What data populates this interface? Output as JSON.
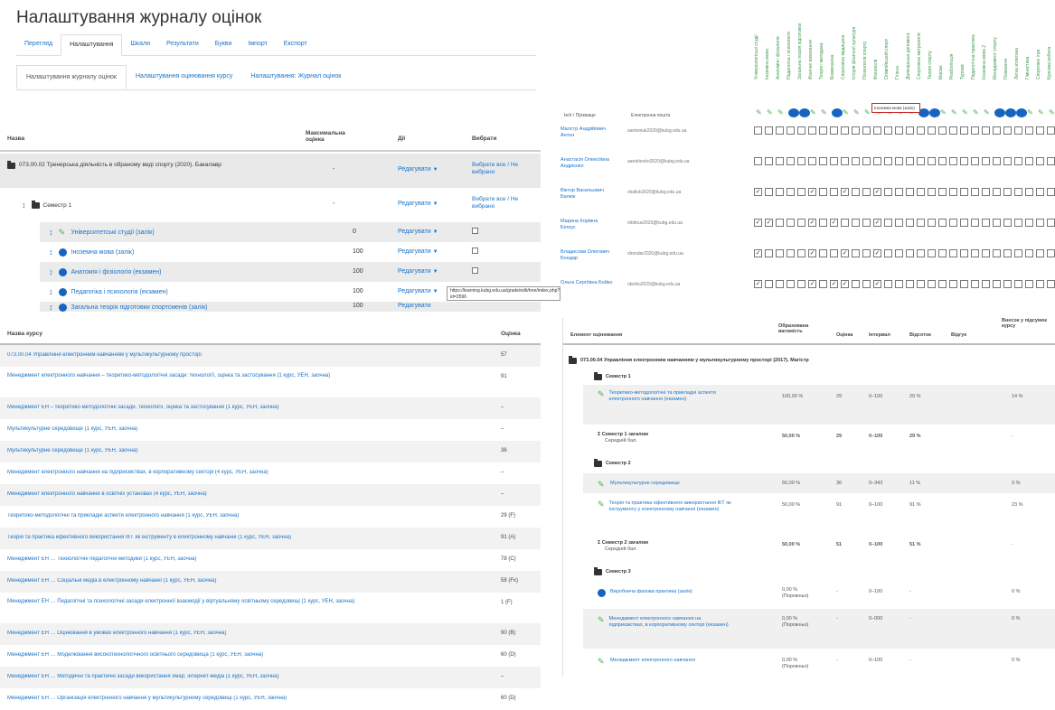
{
  "page": {
    "title": "Налаштування журналу оцінок"
  },
  "tabs_main": [
    "Перегляд",
    "Налаштування",
    "Шкали",
    "Результати",
    "Букви",
    "Імпорт",
    "Експорт"
  ],
  "tabs_sub": [
    "Налаштування журналу оцінок",
    "Налаштування оцінювання курсу",
    "Налаштування: Журнал оцінок"
  ],
  "setup_table": {
    "headers": {
      "name": "Назва",
      "max": "Максимальна оцінка",
      "actions": "Дії",
      "select": "Вибрати"
    },
    "course": {
      "name": "073.00.02 Тренерська діяльність в обраному виді спорту (2020). Бакалавр",
      "max": "-",
      "action": "Редагувати",
      "select": "Вибрати все / Не вибрано"
    },
    "category": {
      "name": "Семестр 1",
      "max": "-",
      "action": "Редагувати",
      "select": "Вибрати все / Не вибрано"
    },
    "items": [
      {
        "icon": "leaf",
        "name": "Університетські студії (залік)",
        "max": "0",
        "action": "Редагувати"
      },
      {
        "icon": "quiz",
        "name": "Іноземна мова (залік)",
        "max": "100",
        "action": "Редагувати"
      },
      {
        "icon": "quiz",
        "name": "Анатомія і фізіологія (екзамен)",
        "max": "100",
        "action": "Редагувати"
      },
      {
        "icon": "quiz",
        "name": "Педагогіка і психологія (екзамен)",
        "max": "100",
        "action": "Редагувати"
      },
      {
        "icon": "quiz",
        "name": "Загальна теорія підготовки спортсменів (залік)",
        "max": "100",
        "action": "Редагувати"
      }
    ],
    "tooltip": "https://learning.kubg.edu.ua/grade/edit/tree/index.php?id=3596"
  },
  "matrix": {
    "col_headers": [
      "Університетські студії",
      "Іноземна мова",
      "Анатомія і фізіологія",
      "Педагогіка і психологія",
      "Загальна теорія підготовки",
      "Фізичне виховання",
      "Теорія і методика",
      "Біомеханіка",
      "Спортивна медицина",
      "Історія фізичної культури",
      "Психологія спорту",
      "Фізіологія",
      "Олімпійський спорт",
      "Гігієна",
      "Долікарська допомога",
      "Спортивна метрологія",
      "Теорія спорту",
      "Масаж",
      "Реабілітація",
      "Туризм",
      "Педагогічна практика",
      "Іноземна мова 2",
      "Менеджмент спорту",
      "Плавання",
      "Легка атлетика",
      "Гімнастика",
      "Спортивні ігри",
      "Курсова робота"
    ],
    "head_name": "Ім'я / Прізвище",
    "head_email": "Електронна пошта",
    "tooltip": "Іноземна мова (залік)",
    "rows": [
      {
        "name": "Магістр Андрійович Антон",
        "email": "aantoniuk2020@kubg.edu.ua",
        "checks": []
      },
      {
        "name": "Анастасія Олексіївна Андрієнко",
        "email": "aandrienko2020@kubg.edu.ua",
        "checks": []
      },
      {
        "name": "Віктор Васильович Балюк",
        "email": "vbaliuk2020@kubg.edu.ua",
        "checks": [
          0,
          5,
          8,
          11
        ]
      },
      {
        "name": "Марина Ігорівна Білоус",
        "email": "mbilous2020@kubg.edu.ua",
        "checks": [
          0,
          1,
          5,
          7,
          11
        ]
      },
      {
        "name": "Владислав Олегович Бондар",
        "email": "vbondar2020@kubg.edu.ua",
        "checks": [
          0,
          5,
          8,
          11
        ]
      },
      {
        "name": "Ольга Сергіївна Бойко",
        "email": "oboiko2020@kubg.edu.ua",
        "checks": [
          0,
          5,
          7,
          8,
          11
        ]
      }
    ]
  },
  "courses": {
    "headers": {
      "name": "Назва курсу",
      "grade": "Оцінка"
    },
    "rows": [
      {
        "name": "073.00.04 Управління електронним навчанням у мультикультурному просторі",
        "grade": "57"
      },
      {
        "name": "Менеджмент електронного навчання – теоретико-методологічні засади: технології, оцінка та застосування (1 курс, УЕН, заочна)",
        "grade": "91",
        "tall": true
      },
      {
        "name": "Менеджмент ЕН – теоретико-методологічні засади, технології, оцінка та застосування (1 курс, УЕН, заочна)",
        "grade": "–"
      },
      {
        "name": "Мультикультурне середовище (1 курс, УЕН, заочна)",
        "grade": "–"
      },
      {
        "name": "Мультикультурне середовище (1 курс, УЕН, заочна)",
        "grade": "36"
      },
      {
        "name": "Менеджмент електронного навчання на підприємствах, в корпоративному секторі (4 курс, УЕН, заочна)",
        "grade": "–"
      },
      {
        "name": "Менеджмент електронного навчання в освітніх установах (4 курс, УЕН, заочна)",
        "grade": "–"
      },
      {
        "name": "Теоретико-методологічні та прикладні аспекти електронного навчання (1 курс, УЕН, заочна)",
        "grade": "29 (F)"
      },
      {
        "name": "Теорія та практика ефективного використання ІКТ як інструменту в електронному навчанні (1 курс, УЕН, заочна)",
        "grade": "91 (A)"
      },
      {
        "name": "Менеджмент ЕН … Технологічні педагогічні методики (1 курс, УЕН, заочна)",
        "grade": "78 (C)"
      },
      {
        "name": "Менеджмент ЕН … Соціальні медіа в електронному навчанні (1 курс, УЕН, заочна)",
        "grade": "58 (Fx)"
      },
      {
        "name": "Менеджмент ЕН … Педагогічні та психологічні засади електронної взаємодії у віртуальному освітньому середовищі (1 курс, УЕН, заочна)",
        "grade": "1 (F)",
        "tall": true
      },
      {
        "name": "Менеджмент ЕН … Оцінювання в умовах електронного навчання (1 курс, УЕН, заочна)",
        "grade": "90 (B)"
      },
      {
        "name": "Менеджмент ЕН … Моделювання високотехнологічного освітнього середовища (1 курс, УЕН, заочна)",
        "grade": "60 (D)"
      },
      {
        "name": "Менеджмент ЕН … Методичні та практичні засади використання хмар, інтернет-медіа (1 курс, УЕН, заочна)",
        "grade": "–"
      },
      {
        "name": "Менеджмент ЕН … Організація електронного навчання у мультикультурному середовищі (1 курс, УЕН, заочна)",
        "grade": "60 (D)"
      }
    ]
  },
  "report": {
    "headers": {
      "item": "Елемент оцінювання",
      "weight": "Обрахована вагомість",
      "grade": "Оцінка",
      "range": "Інтервал",
      "percent": "Відсоток",
      "feedback": "Відгук",
      "contribution": "Внесок у підсумок курсу"
    },
    "course": "073.00.04 Управління електронним навчанням у мультикультурному просторі (2017). Магістр",
    "sem1": "Семестр 1",
    "sem1_item": {
      "name": "Теоретико-методологічні та прикладні аспекти електронного навчання (екзамен)",
      "weight": "100,00 %",
      "grade": "29",
      "range": "0–100",
      "percent": "29 %",
      "contribution": "14 %"
    },
    "sem1_total": {
      "name": "Семестр 1 загалом",
      "sub": "Середній бал.",
      "weight": "50,00 %",
      "grade": "29",
      "range": "0–100",
      "percent": "29 %",
      "contribution": "-"
    },
    "sem2": "Семестр 2",
    "sem2_item1": {
      "name": "Мультикультурне середовище",
      "weight": "50,00 %",
      "grade": "36",
      "range": "0–343",
      "percent": "11 %",
      "contribution": "3 %"
    },
    "sem2_item2": {
      "name": "Теорія та практика ефективного використання ІКТ як інструменту у електронному навчанні (екзамен)",
      "weight": "50,00 %",
      "grade": "91",
      "range": "0–100",
      "percent": "91 %",
      "contribution": "23 %"
    },
    "sem2_total": {
      "name": "Семестр 2 загалом",
      "sub": "Середній бал.",
      "weight": "50,00 %",
      "grade": "51",
      "range": "0–100",
      "percent": "51 %",
      "contribution": "-"
    },
    "sem3": "Семестр 3",
    "sem3_item1": {
      "name": "Виробнича фахова практика (залік)",
      "weight": "0,00 %",
      "weight_sub": "(Порожньо)",
      "grade": "-",
      "range": "0–100",
      "percent": "-",
      "contribution": "0 %"
    },
    "sem3_item2": {
      "name": "Менеджмент електронного навчання на підприємствах, в корпоративному секторі (екзамен)",
      "weight": "0,00 %",
      "weight_sub": "(Порожньо)",
      "grade": "-",
      "range": "0–000",
      "percent": "-",
      "contribution": "0 %"
    },
    "sem3_item3": {
      "name": "Менеджмент електронного навчання",
      "weight": "0,00 %",
      "weight_sub": "(Порожньо)",
      "grade": "-",
      "range": "0–100",
      "percent": "-",
      "contribution": "0 %"
    }
  }
}
